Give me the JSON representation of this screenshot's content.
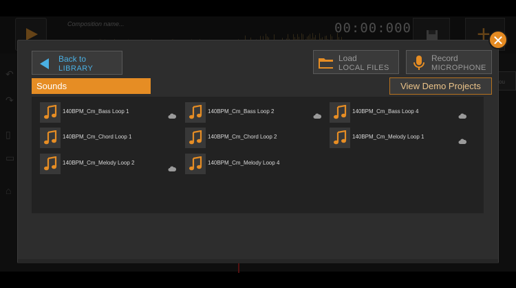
{
  "background_app": {
    "composition_placeholder": "Composition name...",
    "timer": "00:00:000",
    "right_track_label": "ou",
    "add_label": "+"
  },
  "dialog": {
    "back_button": {
      "line1": "Back to",
      "line2": "LIBRARY"
    },
    "load_button": {
      "line1": "Load",
      "line2": "LOCAL FILES"
    },
    "record_button": {
      "line1": "Record",
      "line2": "MICROPHONE"
    },
    "close_glyph": "✕",
    "sounds_tab": "Sounds",
    "demo_button": "View Demo Projects",
    "sounds": [
      {
        "name": "140BPM_Cm_Bass Loop 1",
        "cloud": true
      },
      {
        "name": "140BPM_Cm_Bass Loop 2",
        "cloud": true
      },
      {
        "name": "140BPM_Cm_Bass Loop 4",
        "cloud": true
      },
      {
        "name": "140BPM_Cm_Chord Loop 1",
        "cloud": false
      },
      {
        "name": "140BPM_Cm_Chord Loop 2",
        "cloud": false
      },
      {
        "name": "140BPM_Cm_Melody Loop 1",
        "cloud": true
      },
      {
        "name": "140BPM_Cm_Melody Loop 2",
        "cloud": true
      },
      {
        "name": "140BPM_Cm_Melody Loop 4",
        "cloud": false
      }
    ]
  },
  "icons": {
    "back": "back-arrow-icon",
    "load": "folder-icon",
    "record": "microphone-icon",
    "sound": "music-note-icon",
    "cloud": "cloud-download-icon",
    "close": "close-icon"
  },
  "colors": {
    "accent": "#e68d24",
    "link_blue": "#4ab0e4",
    "dialog_bg": "#2d2d2d",
    "panel_bg": "#222222"
  }
}
